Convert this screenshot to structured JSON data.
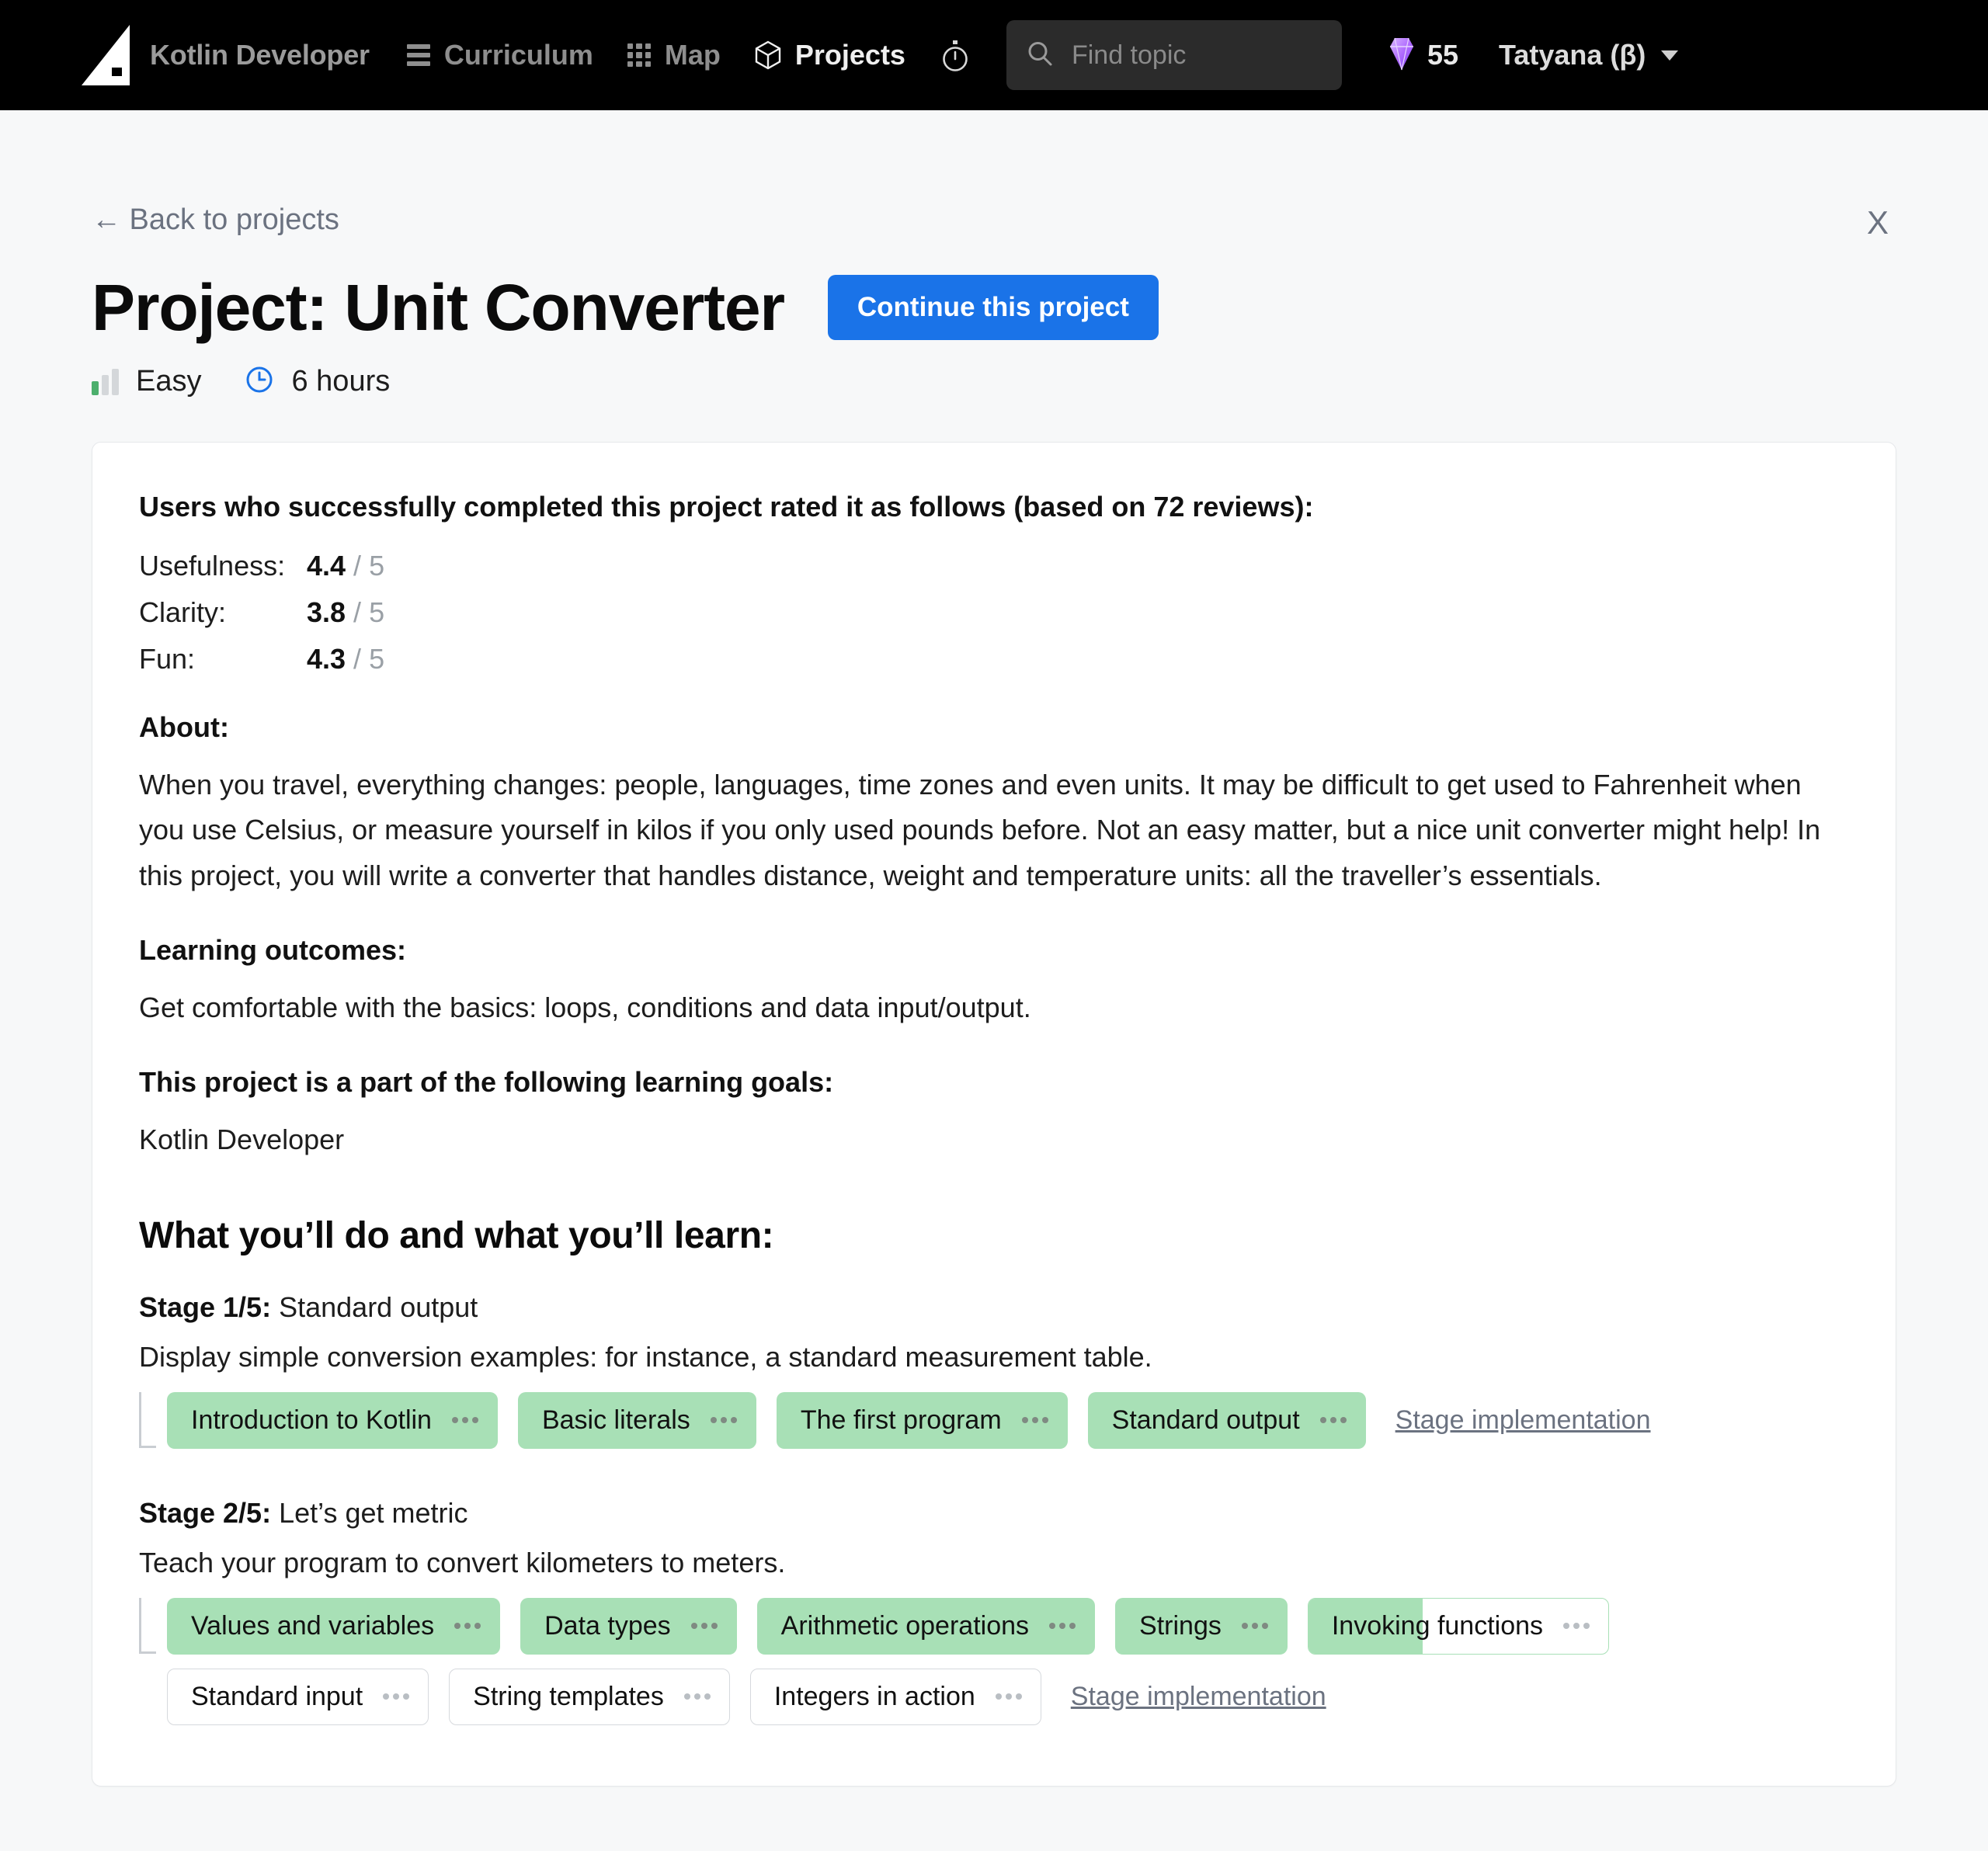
{
  "topnav": {
    "brand": "Kotlin Developer",
    "items": [
      {
        "label": "Curriculum",
        "icon": "hamburger-icon",
        "active": false
      },
      {
        "label": "Map",
        "icon": "grid-icon",
        "active": false
      },
      {
        "label": "Projects",
        "icon": "cube-icon",
        "active": true
      }
    ],
    "timer_icon": "stopwatch-icon",
    "search": {
      "placeholder": "Find topic",
      "value": "",
      "icon": "search-icon"
    },
    "gems": {
      "icon": "gem-icon",
      "count": "55"
    },
    "user": {
      "name": "Tatyana (β)",
      "caret": "chevron-down-icon"
    }
  },
  "page": {
    "back_link": "← Back to projects",
    "close_label": "X",
    "title": "Project: Unit Converter",
    "continue_button": "Continue this project",
    "difficulty": "Easy",
    "duration": "6 hours",
    "difficulty_icon": "bar-level-icon",
    "clock_icon": "clock-icon",
    "accent_blue": "#1a73e8",
    "chip_green": "#a8e0b6"
  },
  "ratings": {
    "heading": "Users who successfully completed this project rated it as follows (based on 72 reviews):",
    "max": "5",
    "items": [
      {
        "label": "Usefulness:",
        "value": "4.4"
      },
      {
        "label": "Clarity:",
        "value": "3.8"
      },
      {
        "label": "Fun:",
        "value": "4.3"
      }
    ]
  },
  "about": {
    "heading": "About:",
    "text": "When you travel, everything changes: people, languages, time zones and even units. It may be difficult to get used to Fahrenheit when you use Celsius, or measure yourself in kilos if you only used pounds before. Not an easy matter, but a nice unit converter might help! In this project, you will write a converter that handles distance, weight and temperature units: all the traveller’s essentials."
  },
  "outcomes": {
    "heading": "Learning outcomes:",
    "text": "Get comfortable with the basics: loops, conditions and data input/output."
  },
  "goals": {
    "heading": "This project is a part of the following learning goals:",
    "text": "Kotlin Developer"
  },
  "stages_section": {
    "heading": "What you’ll do and what you’ll learn:",
    "stage_impl_label": "Stage implementation",
    "stages": [
      {
        "number": "Stage 1/5:",
        "name": "Standard output",
        "description": "Display simple conversion examples: for instance, a standard measurement table.",
        "rows": [
          [
            {
              "label": "Introduction to Kotlin",
              "state": "done"
            },
            {
              "label": "Basic literals",
              "state": "done"
            },
            {
              "label": "The first program",
              "state": "done"
            },
            {
              "label": "Standard output",
              "state": "done"
            }
          ]
        ],
        "impl_on_row": 0
      },
      {
        "number": "Stage 2/5:",
        "name": "Let’s get metric",
        "description": "Teach your program to convert kilometers to meters.",
        "rows": [
          [
            {
              "label": "Values and variables",
              "state": "done"
            },
            {
              "label": "Data types",
              "state": "done"
            },
            {
              "label": "Arithmetic operations",
              "state": "done"
            },
            {
              "label": "Strings",
              "state": "done"
            },
            {
              "label": "Invoking functions",
              "state": "partial",
              "progress": "38%"
            }
          ],
          [
            {
              "label": "Standard input",
              "state": "todo"
            },
            {
              "label": "String templates",
              "state": "todo"
            },
            {
              "label": "Integers in action",
              "state": "todo"
            }
          ]
        ],
        "impl_on_row": 1
      }
    ]
  }
}
